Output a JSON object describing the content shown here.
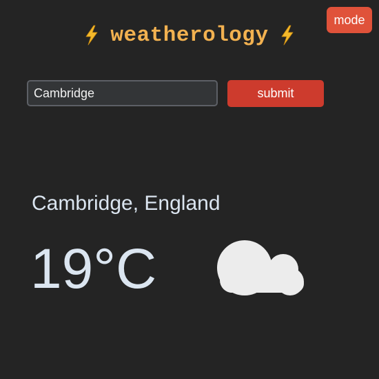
{
  "header": {
    "title": "weatherology",
    "left_icon": "lightning-bolt",
    "right_icon": "lightning-bolt"
  },
  "mode_button": {
    "label": "mode"
  },
  "search": {
    "value": "Cambridge",
    "placeholder": ""
  },
  "submit_button": {
    "label": "submit"
  },
  "weather": {
    "location": "Cambridge, England",
    "temperature": "19°C",
    "condition_icon": "cloud-icon"
  },
  "colors": {
    "background": "#242424",
    "title": "#f2b150",
    "bolt": "#f4b92b",
    "mode_button": "#e0523a",
    "submit_button": "#cd3b2d",
    "text": "#dbe5f0",
    "cloud": "#ececec"
  }
}
